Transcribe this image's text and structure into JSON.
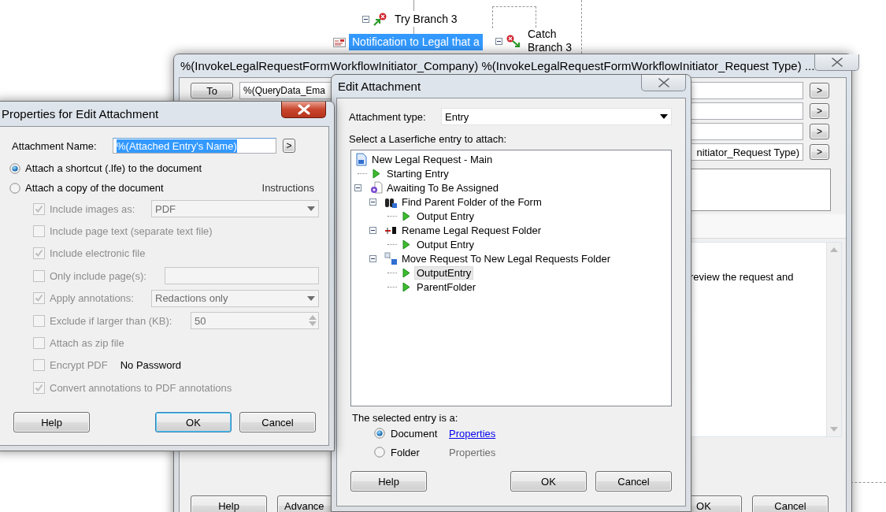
{
  "diagram": {
    "nodes": [
      {
        "kind": "try",
        "label": "Try Branch 3",
        "expanded": true,
        "selected": false
      },
      {
        "kind": "notification",
        "label": "Notification to Legal that a",
        "expanded": false,
        "selected": true
      },
      {
        "kind": "catch",
        "label": "Catch Branch 3",
        "expanded": true,
        "selected": false
      }
    ]
  },
  "email_window": {
    "title": "%(InvokeLegalRequestFormWorkflowInitiator_Company) %(InvokeLegalRequestFormWorkflowInitiator_Request Type) ...",
    "fields": [
      {
        "kind": "recipient",
        "button": "To",
        "value": "%(QueryData_Ema",
        "insert": ">"
      },
      {
        "kind": "blank",
        "insert": ">"
      },
      {
        "kind": "blank",
        "insert": ">"
      },
      {
        "kind": "subject",
        "value": "nitiator_Request Type)",
        "insert": ">"
      }
    ],
    "body_text": "review the request and",
    "left_buttons": [
      "Help",
      "Advance"
    ],
    "right_buttons": [
      "OK",
      "Cancel"
    ]
  },
  "properties_window": {
    "title": "Properties for Edit Attachment",
    "attachment_name": {
      "label": "Attachment Name:",
      "value": "%(Attached Entry's Name)",
      "insert": ">"
    },
    "modes": [
      {
        "label": "Attach a shortcut (.lfe) to the document",
        "selected": true
      },
      {
        "label": "Attach a copy of the document",
        "selected": false,
        "link": "Instructions"
      }
    ],
    "options": [
      {
        "kind": "select",
        "label": "Include images as:",
        "checked": true,
        "disabled": true,
        "value": "PDF"
      },
      {
        "kind": "check",
        "label": "Include page text (separate text file)",
        "checked": false,
        "disabled": true
      },
      {
        "kind": "check",
        "label": "Include electronic file",
        "checked": true,
        "disabled": true
      },
      {
        "kind": "text",
        "label": "Only include page(s):",
        "checked": false,
        "disabled": true
      },
      {
        "kind": "select",
        "label": "Apply annotations:",
        "checked": true,
        "disabled": true,
        "value": "Redactions only"
      },
      {
        "kind": "spin",
        "label": "Exclude if larger than (KB):",
        "checked": false,
        "disabled": true,
        "value": "50"
      },
      {
        "kind": "check",
        "label": "Attach as zip file",
        "checked": false,
        "disabled": true
      },
      {
        "kind": "note",
        "label": "Encrypt PDF",
        "checked": false,
        "disabled": true,
        "note": "No Password"
      },
      {
        "kind": "check",
        "label": "Convert annotations to PDF annotations",
        "checked": true,
        "disabled": true
      }
    ],
    "buttons": [
      {
        "label": "Help",
        "default": false
      },
      {
        "label": "OK",
        "default": true
      },
      {
        "label": "Cancel",
        "default": false
      }
    ]
  },
  "edit_window": {
    "title": "Edit Attachment",
    "attachment_type": {
      "label": "Attachment type:",
      "value": "Entry"
    },
    "tree_label": "Select a Laserfiche entry to attach:",
    "tree": [
      {
        "kind": "workflow",
        "label": "New Legal Request - Main",
        "selected": false,
        "children": [
          {
            "kind": "output",
            "label": "Starting Entry",
            "selected": false
          },
          {
            "kind": "activity",
            "label": "Awaiting To Be Assigned",
            "expanded": true,
            "selected": false,
            "children": [
              {
                "kind": "find",
                "label": "Find Parent Folder of the Form",
                "expanded": true,
                "selected": false,
                "children": [
                  {
                    "kind": "output",
                    "label": "Output Entry",
                    "selected": false
                  }
                ]
              },
              {
                "kind": "rename",
                "label": "Rename Legal Request Folder",
                "expanded": true,
                "selected": false,
                "children": [
                  {
                    "kind": "output",
                    "label": "Output Entry",
                    "selected": false
                  }
                ]
              },
              {
                "kind": "move",
                "label": "Move Request To New Legal Requests Folder",
                "expanded": true,
                "selected": false,
                "children": [
                  {
                    "kind": "output",
                    "label": "OutputEntry",
                    "selected": true
                  },
                  {
                    "kind": "output",
                    "label": "ParentFolder",
                    "selected": false
                  }
                ]
              }
            ]
          }
        ]
      }
    ],
    "selected_label": "The selected entry is a:",
    "entry_types": [
      {
        "label": "Document",
        "selected": true,
        "properties": "Properties",
        "link_enabled": true
      },
      {
        "label": "Folder",
        "selected": false,
        "properties": "Properties",
        "link_enabled": false
      }
    ],
    "left_buttons": [
      "Help"
    ],
    "right_buttons": [
      "OK",
      "Cancel"
    ]
  }
}
